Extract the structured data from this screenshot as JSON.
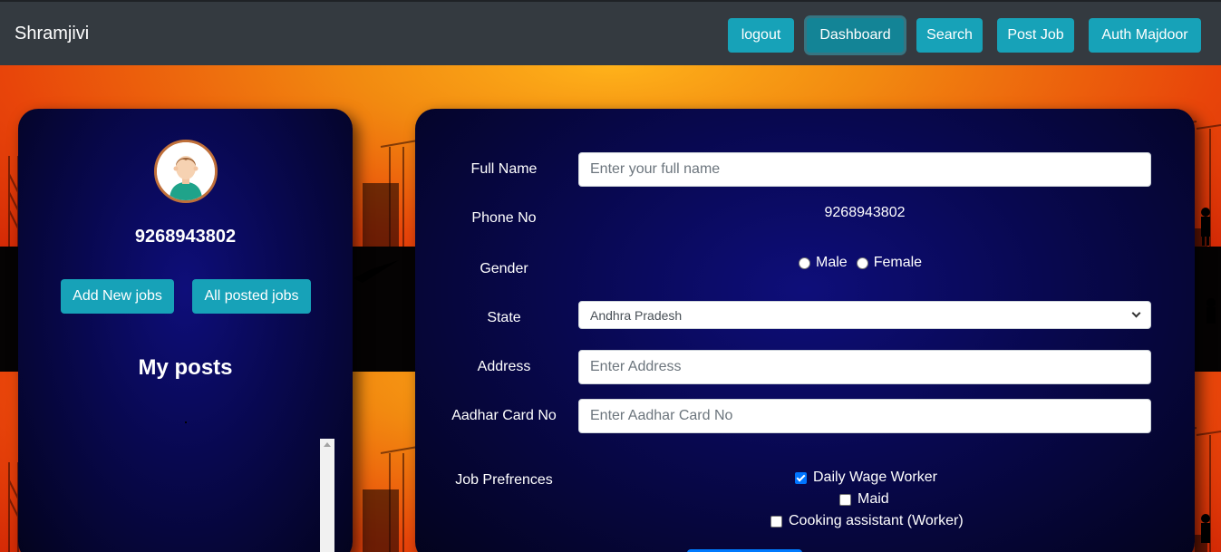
{
  "navbar": {
    "brand": "Shramjivi",
    "buttons": [
      {
        "label": "logout"
      },
      {
        "label": "Dashboard"
      },
      {
        "label": "Search"
      },
      {
        "label": "Post Job"
      },
      {
        "label": "Auth Majdoor"
      }
    ]
  },
  "profile": {
    "phone": "9268943802",
    "add_jobs_label": "Add New jobs",
    "all_jobs_label": "All posted jobs",
    "my_posts_title": "My posts"
  },
  "form": {
    "full_name_label": "Full Name",
    "full_name_placeholder": "Enter your full name",
    "phone_label": "Phone No",
    "phone_value": "9268943802",
    "gender_label": "Gender",
    "gender_options": [
      "Male",
      "Female"
    ],
    "state_label": "State",
    "state_selected": "Andhra Pradesh",
    "address_label": "Address",
    "address_placeholder": "Enter Address",
    "aadhar_label": "Aadhar Card No",
    "aadhar_placeholder": "Enter Aadhar Card No",
    "job_pref_label": "Job Prefrences",
    "job_prefs": [
      {
        "label": "Daily Wage Worker",
        "checked": true
      },
      {
        "label": "Maid",
        "checked": false
      },
      {
        "label": "Cooking assistant (Worker)",
        "checked": false
      }
    ]
  },
  "colors": {
    "navbar_bg": "#343a40",
    "button_info": "#17a2b8",
    "card_bg": "#08084f",
    "primary": "#007bff"
  }
}
